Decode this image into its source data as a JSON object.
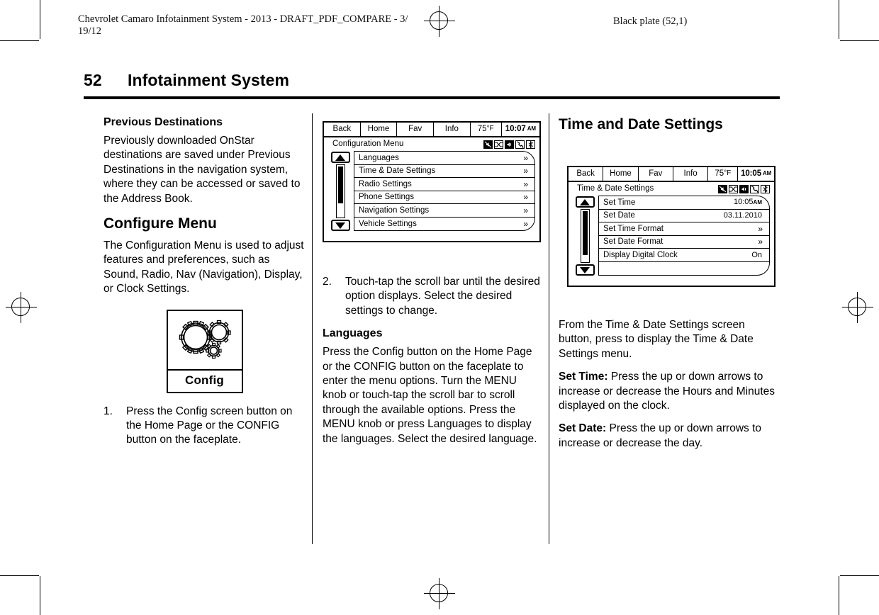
{
  "running_head": {
    "left": "Chevrolet Camaro Infotainment System - 2013 - DRAFT_PDF_COMPARE - 3/\n19/12",
    "right": "Black plate (52,1)"
  },
  "page": {
    "number": "52",
    "title": "Infotainment System"
  },
  "column1": {
    "heading_previous_destinations": "Previous Destinations",
    "para_previous_destinations": "Previously downloaded OnStar destinations are saved under Previous Destinations in the navigation system, where they can be accessed or saved to the Address Book.",
    "heading_configure_menu": "Configure Menu",
    "para_configure_menu": "The Configuration Menu is used to adjust features and preferences, such as Sound, Radio, Nav (Navigation), Display, or Clock Settings.",
    "config_button_art": {
      "caption": "Config",
      "icon": "gears-icon"
    },
    "step1_num": "1.",
    "step1_text": "Press the Config screen button on the Home Page or the CONFIG button on the faceplate."
  },
  "column2": {
    "screen_config": {
      "topbar": [
        {
          "label": "Back",
          "kind": "button"
        },
        {
          "label": "Home",
          "kind": "button"
        },
        {
          "label": "Fav",
          "kind": "button"
        },
        {
          "label": "Info",
          "kind": "button"
        },
        {
          "label": "75",
          "unit": "°F",
          "kind": "temperature"
        },
        {
          "label": "10:07",
          "suffix": "AM",
          "kind": "clock"
        }
      ],
      "title": "Configuration Menu",
      "status_icons": [
        "no-audio-icon",
        "shuffle-icon",
        "mute-icon",
        "phone-icon",
        "bluetooth-icon"
      ],
      "rows": [
        {
          "label": "Languages",
          "value": "",
          "chevron": true
        },
        {
          "label": "Time & Date Settings",
          "value": "",
          "chevron": true
        },
        {
          "label": "Radio Settings",
          "value": "",
          "chevron": true
        },
        {
          "label": "Phone Settings",
          "value": "",
          "chevron": true
        },
        {
          "label": "Navigation Settings",
          "value": "",
          "chevron": true
        },
        {
          "label": "Vehicle Settings",
          "value": "",
          "chevron": true
        }
      ]
    },
    "step2_num": "2.",
    "step2_text": "Touch-tap the scroll bar until the desired option displays. Select the desired settings to change.",
    "heading_languages": "Languages",
    "para_languages": "Press the Config button on the Home Page or the CONFIG button on the faceplate to enter the menu options. Turn the MENU knob or touch-tap the scroll bar to scroll through the available options. Press the MENU knob or press Languages to display the languages. Select the desired language."
  },
  "column3": {
    "heading_time_and_date": "Time and Date Settings",
    "screen_time_date": {
      "topbar": [
        {
          "label": "Back",
          "kind": "button"
        },
        {
          "label": "Home",
          "kind": "button"
        },
        {
          "label": "Fav",
          "kind": "button"
        },
        {
          "label": "Info",
          "kind": "button"
        },
        {
          "label": "75",
          "unit": "°F",
          "kind": "temperature"
        },
        {
          "label": "10:05",
          "suffix": "AM",
          "kind": "clock"
        }
      ],
      "title": "Time & Date Settings",
      "status_icons": [
        "no-audio-icon",
        "shuffle-icon",
        "mute-icon",
        "phone-icon",
        "bluetooth-icon"
      ],
      "rows": [
        {
          "label": "Set Time",
          "value": "10:05",
          "value_suffix": "AM",
          "chevron": false
        },
        {
          "label": "Set Date",
          "value": "03.11.2010",
          "chevron": false
        },
        {
          "label": "Set Time Format",
          "value": "",
          "chevron": true
        },
        {
          "label": "Set Date Format",
          "value": "",
          "chevron": true
        },
        {
          "label": "Display Digital Clock",
          "value": "On",
          "chevron": false
        },
        {
          "label": "",
          "value": "",
          "chevron": false
        }
      ]
    },
    "para_from_time_date": "From the Time & Date Settings screen button, press to display the Time & Date Settings menu.",
    "set_time_label": "Set Time:",
    "set_time_text": " Press the up or down arrows to increase or decrease the Hours and Minutes displayed on the clock.",
    "set_date_label": "Set Date:",
    "set_date_text": " Press the up or down arrows to increase or decrease the day."
  }
}
